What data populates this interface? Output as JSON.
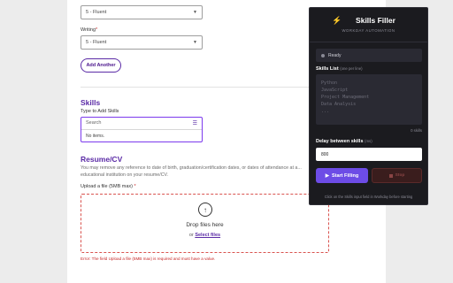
{
  "form": {
    "top_select_value": "5 - Fluent",
    "writing_label": "Writing",
    "required_mark": "*",
    "writing_value": "5 - Fluent",
    "add_another_label": "Add Another",
    "skills_title": "Skills",
    "skills_type_label": "Type to Add Skills",
    "skills_search_placeholder": "Search",
    "skills_no_items": "No items.",
    "resume_title": "Resume/CV",
    "resume_desc": "You may remove any reference to date of birth, graduation/certification dates, or dates of attendance at a... educational institution on your resume/CV.",
    "upload_label": "Upload a file (5MB max)",
    "drop_text": "Drop files here",
    "or_text": "or",
    "select_files": "Select files",
    "error_text": "Error: The field Upload a file (5MB max) is required and must have a value."
  },
  "panel": {
    "title": "Skills Filler",
    "subtitle": "WORKDAY AUTOMATION",
    "status": "Ready",
    "skills_list_label": "Skills List",
    "skills_list_hint": "(one per line)",
    "textarea_placeholder": "Python\nJavaScript\nProject Management\nData Analysis\n...",
    "skills_count": "0 skills",
    "delay_label": "Delay between skills",
    "delay_hint": "(ms)",
    "delay_value": "800",
    "start_label": "Start Filling",
    "stop_label": "Stop",
    "footer": "Click on the Skills input field in Workday before starting"
  },
  "colors": {
    "accent": "#5b2ba6",
    "panel_bg": "#1b1b1f",
    "start_button": "#6d4ce6",
    "error": "#c62828"
  }
}
